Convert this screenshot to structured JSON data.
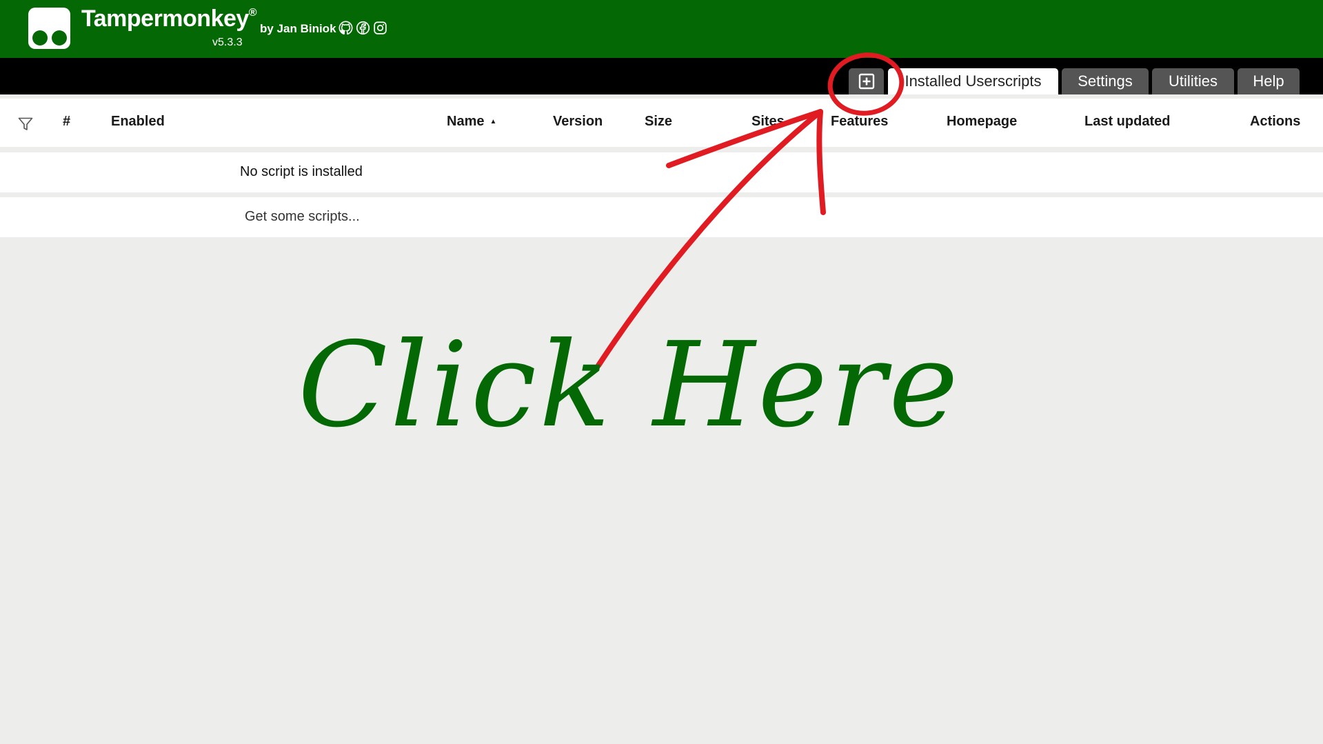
{
  "header": {
    "app_title": "Tampermonkey",
    "registered_mark": "®",
    "version": "v5.3.3",
    "byline": "by Jan Biniok",
    "social_icons": [
      "github-icon",
      "facebook-icon",
      "instagram-icon"
    ],
    "brand_color": "#046905"
  },
  "tabs": {
    "new_script_icon": "plus-square-icon",
    "items": [
      {
        "label": "Installed Userscripts",
        "active": true
      },
      {
        "label": "Settings",
        "active": false
      },
      {
        "label": "Utilities",
        "active": false
      },
      {
        "label": "Help",
        "active": false
      }
    ]
  },
  "table": {
    "filter_icon": "filter-icon",
    "columns": {
      "number": "#",
      "enabled": "Enabled",
      "name": "Name",
      "version": "Version",
      "size": "Size",
      "sites": "Sites",
      "features": "Features",
      "homepage": "Homepage",
      "last_updated": "Last updated",
      "actions": "Actions"
    },
    "sort_indicator": "▲",
    "empty_message": "No script is installed",
    "get_scripts_link": "Get some scripts..."
  },
  "annotation": {
    "text": "Click Here",
    "arrow_color": "#e11b22",
    "text_color": "#046905"
  }
}
